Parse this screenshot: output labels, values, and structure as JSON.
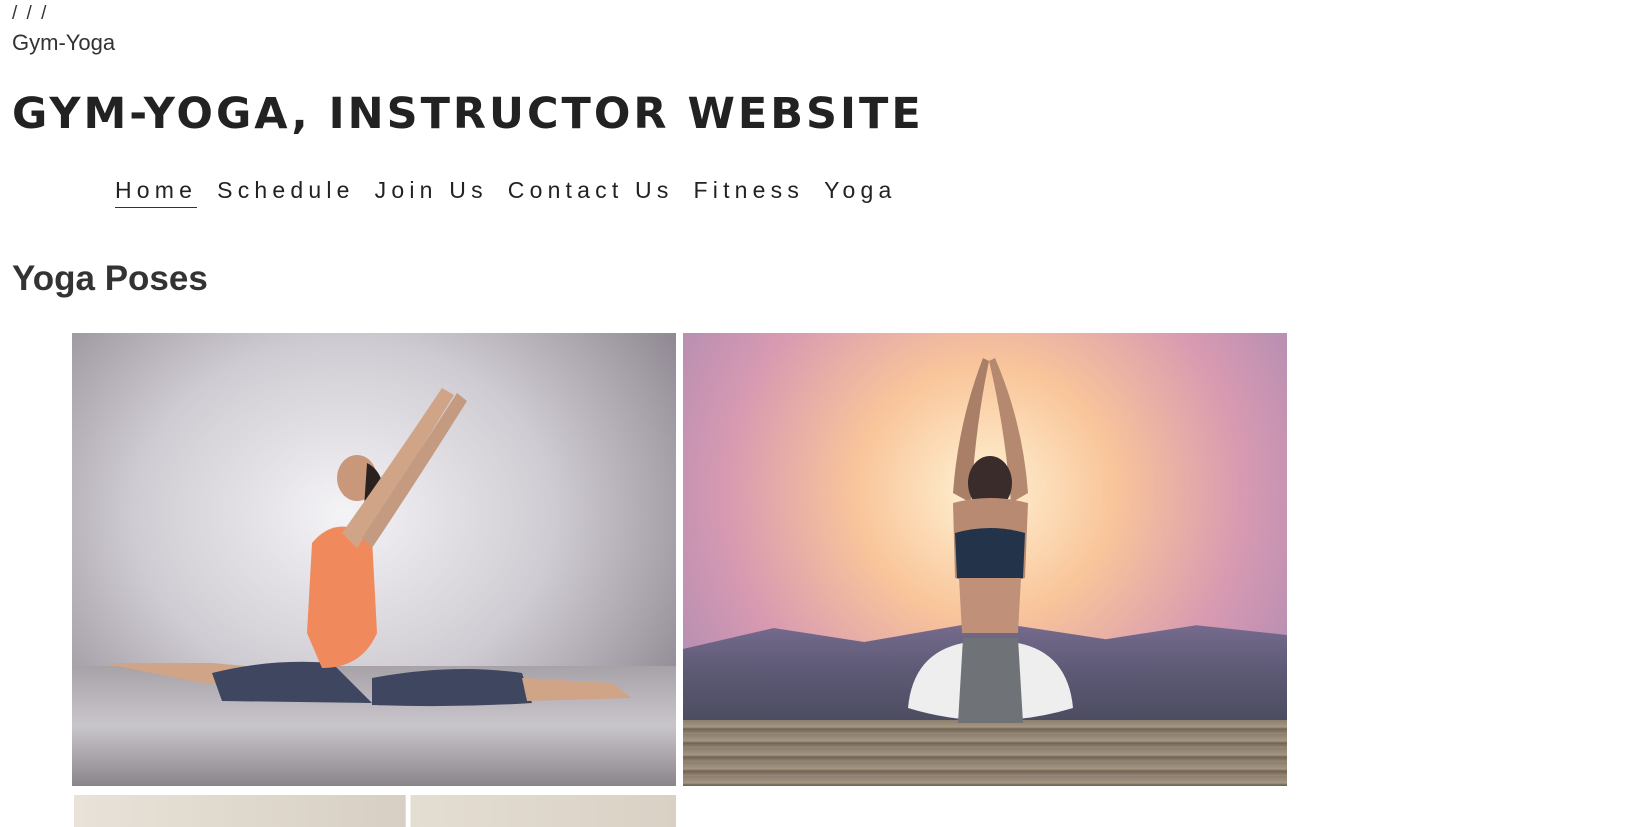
{
  "breadcrumb": "/ / /",
  "site_name": "Gym-Yoga",
  "site_title": "GYM-YOGA, INSTRUCTOR WEBSITE",
  "nav": [
    {
      "label": "Home",
      "active": true
    },
    {
      "label": "Schedule",
      "active": false
    },
    {
      "label": "Join Us",
      "active": false
    },
    {
      "label": "Contact Us",
      "active": false
    },
    {
      "label": "Fitness",
      "active": false
    },
    {
      "label": "Yoga",
      "active": false
    }
  ],
  "section": {
    "title": "Yoga Poses"
  },
  "gallery": {
    "photos": [
      {
        "name": "split-pose-photo"
      },
      {
        "name": "sunset-meditation-photo"
      },
      {
        "name": "third-pose-photo"
      }
    ]
  }
}
